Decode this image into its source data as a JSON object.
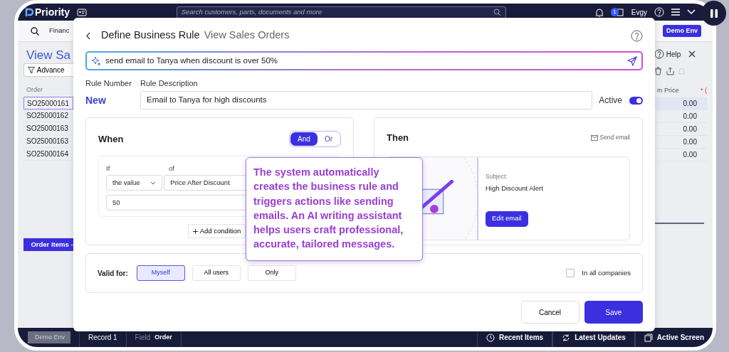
{
  "app": {
    "logo": "Priority",
    "search_placeholder": "Search customers, parts, documents and more",
    "notification_count": "1",
    "user": "Evgy",
    "menu_item": "Financ",
    "env_badge": "Demo Env",
    "page_title": "View Sa",
    "help": "Help",
    "filter_button": "Advance"
  },
  "orders_table": {
    "columns": [
      "Order",
      "m Price",
      "* ("
    ],
    "rows": [
      {
        "order": "SO25000161",
        "price": "0.00",
        "selected": true
      },
      {
        "order": "SO25000162",
        "price": "0.00",
        "selected": false
      },
      {
        "order": "SO25000163",
        "price": "0.00",
        "selected": false
      },
      {
        "order": "SO25000163",
        "price": "0.00",
        "selected": false
      },
      {
        "order": "SO25000164",
        "price": "0.00",
        "selected": false
      }
    ]
  },
  "subform_tab": "Order Items -",
  "status_bar": {
    "env": "Demo Env",
    "record": "Record 1",
    "field_label": "Field",
    "field_value": "Order",
    "items": [
      "Recent Items",
      "Latest Updates",
      "Active Screen"
    ]
  },
  "dialog": {
    "title": "Define Business Rule",
    "subtitle": "View Sales Orders",
    "prompt": "send email to Tanya when discount is over 50%",
    "rule_number_label": "Rule Number",
    "rule_description_label": "Rule Description",
    "rule_number": "New",
    "rule_description": "Email to Tanya for high discounts",
    "active_label": "Active",
    "active": true,
    "when": {
      "title": "When",
      "operators": [
        {
          "label": "And",
          "selected": true
        },
        {
          "label": "Or",
          "selected": false
        }
      ],
      "condition": {
        "if_label": "If",
        "of_label": "of",
        "operand": "the value",
        "field": "Price After Discount",
        "value": "50"
      },
      "add_button": "Add condition"
    },
    "then": {
      "title": "Then",
      "action": "Send email",
      "subject_label": "Subject:",
      "subject": "High Discount Alert",
      "edit_button": "Edit email"
    },
    "valid_for": {
      "label": "Valid for:",
      "options": [
        {
          "label": "Myself",
          "selected": true
        },
        {
          "label": "All users",
          "selected": false
        },
        {
          "label": "Only",
          "selected": false
        }
      ],
      "all_companies_label": "In all companies",
      "all_companies": false
    },
    "buttons": {
      "cancel": "Cancel",
      "save": "Save"
    }
  },
  "tooltip": {
    "text": "The system automatically creates the business rule and triggers actions like sending emails. An AI writing assistant helps users craft professional, accurate, tailored messages."
  }
}
